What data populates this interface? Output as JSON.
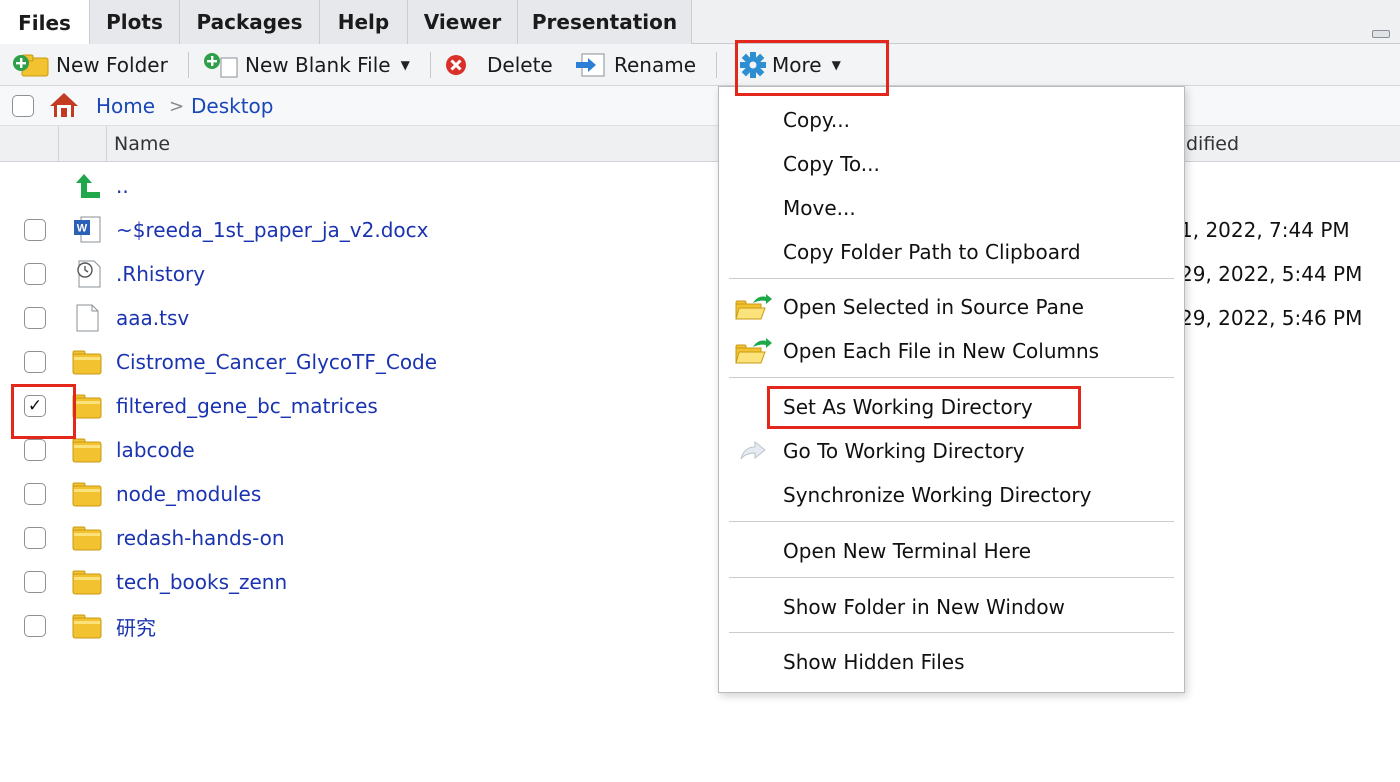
{
  "tabs": [
    {
      "label": "Files",
      "active": true
    },
    {
      "label": "Plots",
      "active": false
    },
    {
      "label": "Packages",
      "active": false
    },
    {
      "label": "Help",
      "active": false
    },
    {
      "label": "Viewer",
      "active": false
    },
    {
      "label": "Presentation",
      "active": false
    }
  ],
  "toolbar": {
    "new_folder": "New Folder",
    "new_blank_file": "New Blank File",
    "delete": "Delete",
    "rename": "Rename",
    "more": "More"
  },
  "breadcrumb": {
    "home": "Home",
    "separator": ">",
    "current": "Desktop"
  },
  "columns": {
    "name": "Name",
    "modified": "dified"
  },
  "files": [
    {
      "name": "..",
      "icon": "up-arrow-icon",
      "modified": "",
      "checked": false,
      "checkbox": false
    },
    {
      "name": "~$reeda_1st_paper_ja_v2.docx",
      "icon": "word-doc-icon",
      "modified": "1, 2022, 7:44 PM",
      "checked": false,
      "checkbox": true
    },
    {
      "name": ".Rhistory",
      "icon": "history-file-icon",
      "modified": "29, 2022, 5:44 PM",
      "checked": false,
      "checkbox": true
    },
    {
      "name": "aaa.tsv",
      "icon": "blank-file-icon",
      "modified": "29, 2022, 5:46 PM",
      "checked": false,
      "checkbox": true
    },
    {
      "name": "Cistrome_Cancer_GlycoTF_Code",
      "icon": "folder-icon",
      "modified": "",
      "checked": false,
      "checkbox": true
    },
    {
      "name": "filtered_gene_bc_matrices",
      "icon": "folder-icon",
      "modified": "",
      "checked": true,
      "checkbox": true
    },
    {
      "name": "labcode",
      "icon": "folder-icon",
      "modified": "",
      "checked": false,
      "checkbox": true
    },
    {
      "name": "node_modules",
      "icon": "folder-icon",
      "modified": "",
      "checked": false,
      "checkbox": true
    },
    {
      "name": "redash-hands-on",
      "icon": "folder-icon",
      "modified": "",
      "checked": false,
      "checkbox": true
    },
    {
      "name": "tech_books_zenn",
      "icon": "folder-icon",
      "modified": "",
      "checked": false,
      "checkbox": true
    },
    {
      "name": "研究",
      "icon": "folder-icon",
      "modified": "",
      "checked": false,
      "checkbox": true
    }
  ],
  "menu": {
    "items": [
      {
        "label": "Copy...",
        "icon": ""
      },
      {
        "label": "Copy To...",
        "icon": ""
      },
      {
        "label": "Move...",
        "icon": ""
      },
      {
        "label": "Copy Folder Path to Clipboard",
        "icon": ""
      },
      {
        "label": "Open Selected in Source Pane",
        "icon": "open-folder-arrow-icon"
      },
      {
        "label": "Open Each File in New Columns",
        "icon": "open-folder-arrow-icon"
      },
      {
        "label": "Set As Working Directory",
        "icon": ""
      },
      {
        "label": "Go To Working Directory",
        "icon": "forward-arrow-icon"
      },
      {
        "label": "Synchronize Working Directory",
        "icon": ""
      },
      {
        "label": "Open New Terminal Here",
        "icon": ""
      },
      {
        "label": "Show Folder in New Window",
        "icon": ""
      },
      {
        "label": "Show Hidden Files",
        "icon": ""
      }
    ]
  },
  "colors": {
    "link": "#1a33b0",
    "highlight": "#e4271b",
    "folder": "#f2c230"
  }
}
